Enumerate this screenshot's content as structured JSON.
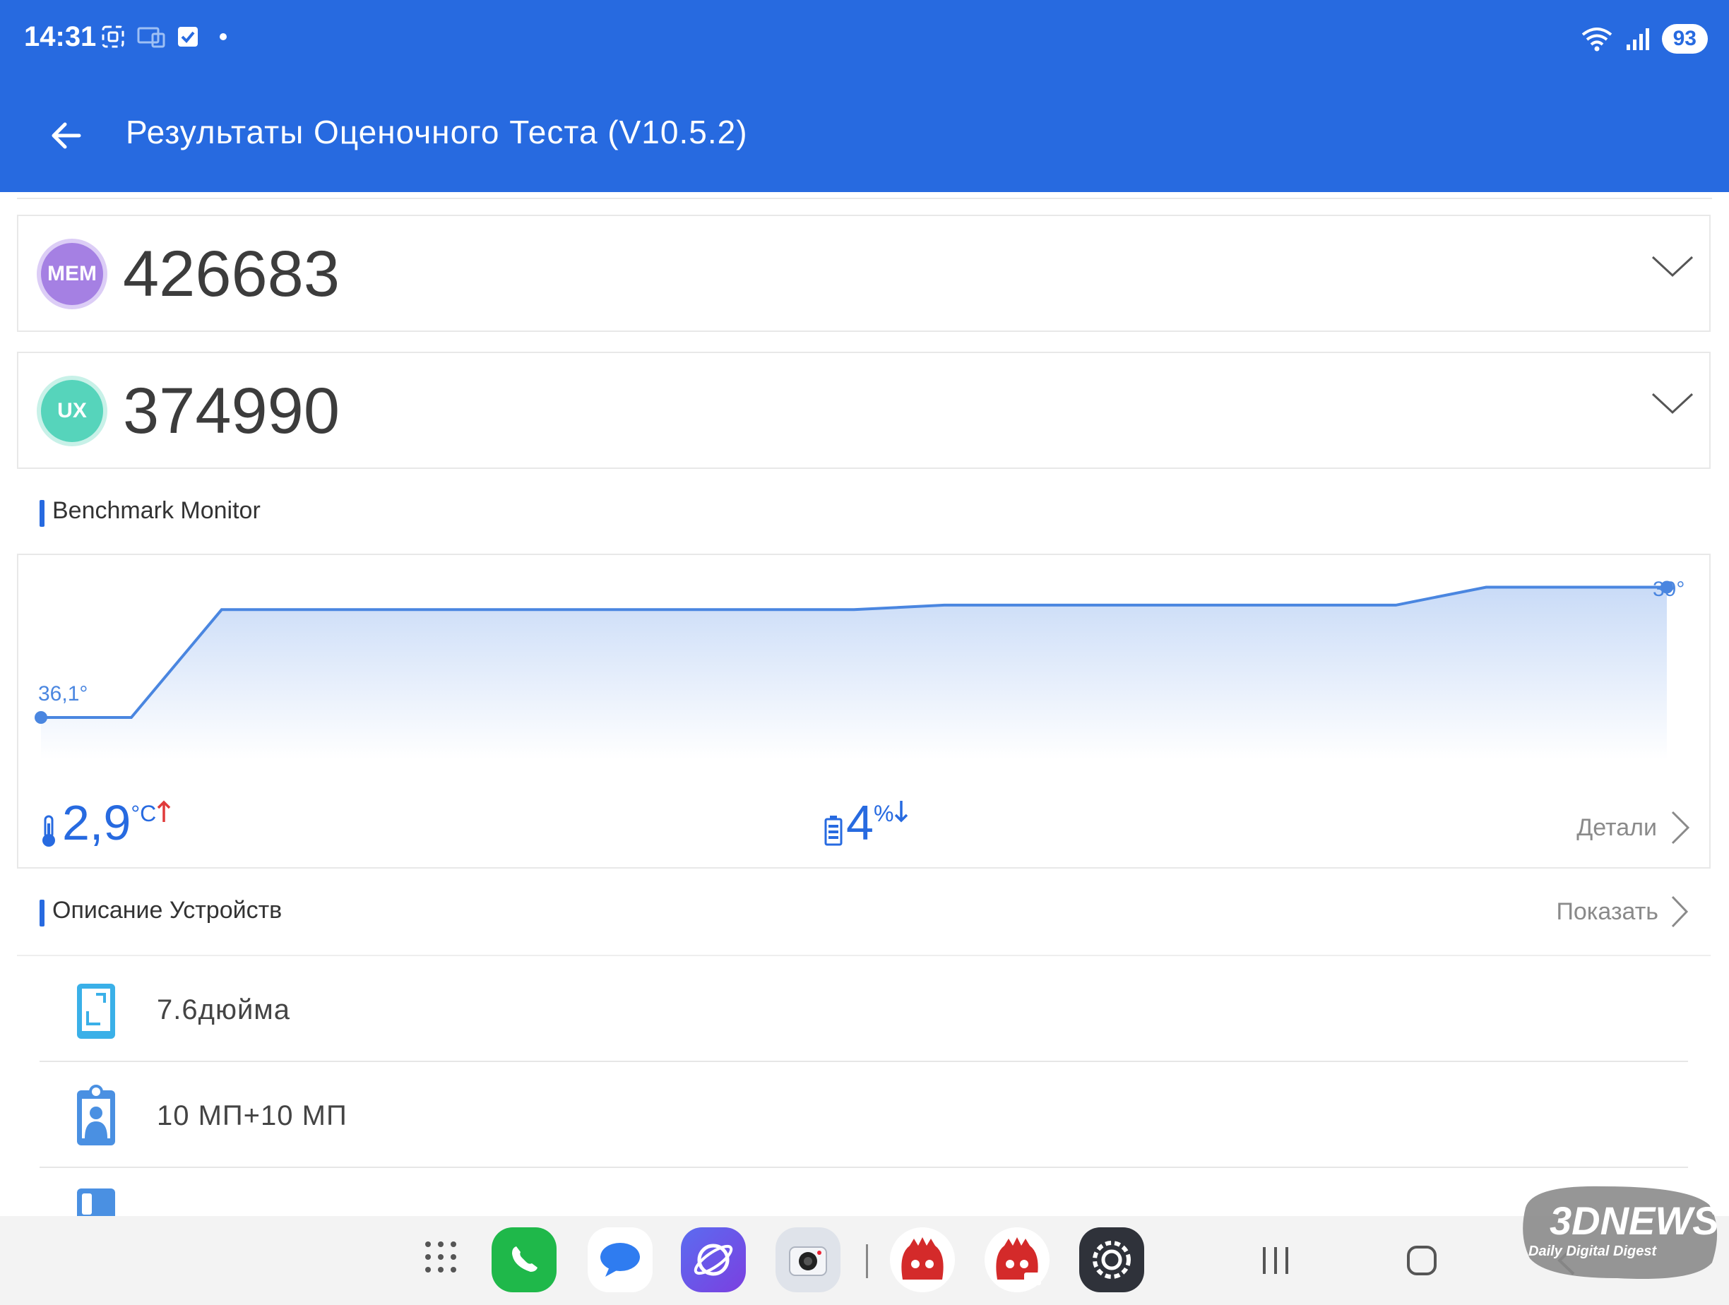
{
  "status_bar": {
    "time": "14:31",
    "battery": "93",
    "icons_left": [
      "screenshot-icon",
      "cast-icon",
      "checkbox-icon",
      "dot-icon"
    ],
    "icons_right": [
      "wifi-icon",
      "signal-icon",
      "battery-icon"
    ]
  },
  "header": {
    "title": "Результаты Оценочного Теста (V10.5.2)"
  },
  "scores": [
    {
      "badge": "MEM",
      "value": "426683",
      "color": "#a07be0"
    },
    {
      "badge": "UX",
      "value": "374990",
      "color": "#4fd2b8"
    }
  ],
  "monitor": {
    "title": "Benchmark Monitor",
    "start_label": "36,1°",
    "end_label": "39°",
    "temp_delta": "2,9",
    "temp_unit": "°C",
    "battery_delta": "4",
    "battery_unit": "%",
    "details_label": "Детали"
  },
  "chart_data": {
    "type": "area",
    "title": "",
    "xlabel": "",
    "ylabel": "",
    "series": [
      {
        "values": [
          36.1,
          36.1,
          38.5,
          38.5,
          38.5,
          38.5,
          38.5,
          38.5,
          38.5,
          38.5,
          38.6,
          38.6,
          38.6,
          38.6,
          38.6,
          38.6,
          39.0,
          39.0,
          39.0
        ]
      }
    ],
    "x": [
      0,
      1,
      2,
      3,
      4,
      5,
      6,
      7,
      8,
      9,
      10,
      11,
      12,
      13,
      14,
      15,
      16,
      17,
      18
    ],
    "ylim": [
      35.0,
      39.4
    ],
    "grid": false,
    "color": "#4a86e0"
  },
  "device": {
    "title": "Описание Устройств",
    "show_label": "Показать",
    "items": [
      {
        "icon": "screen-icon",
        "text": "7.6дюйма"
      },
      {
        "icon": "front-camera-icon",
        "text": "10 МП+10 МП"
      },
      {
        "icon": "rear-camera-icon",
        "text": ""
      }
    ]
  },
  "taskbar": {
    "apps": [
      "apps-grid-icon",
      "phone-icon",
      "messages-icon",
      "browser-icon",
      "camera-icon",
      "antutu-icon",
      "antutu-3d-icon",
      "settings-icon"
    ],
    "nav": [
      "recents-button",
      "home-button",
      "back-button"
    ]
  },
  "watermark": {
    "brand": "3DNEWS",
    "tagline": "Daily Digital Digest"
  }
}
